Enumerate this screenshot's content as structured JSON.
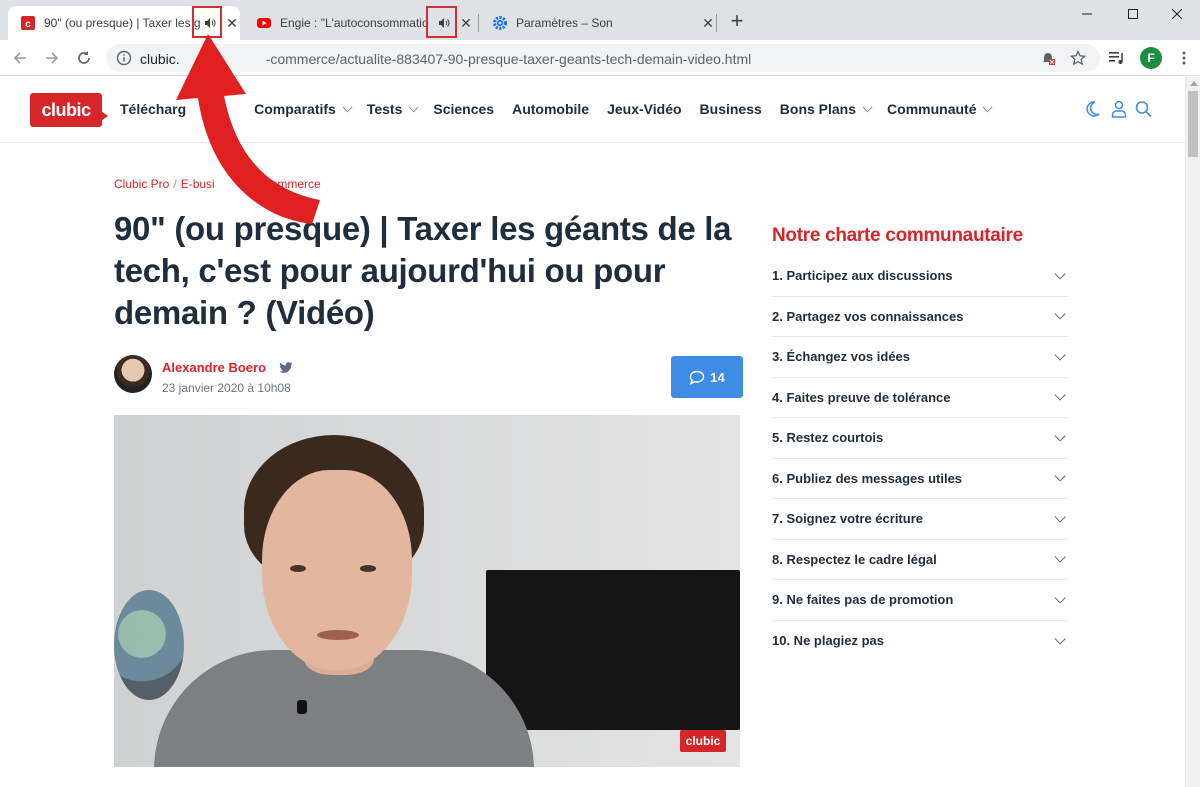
{
  "browser": {
    "tabs": [
      {
        "title": "90\" (ou presque) | Taxer les g",
        "favicon": "clubic-favicon",
        "audio": true,
        "active": true
      },
      {
        "title": "Engie : \"L'autoconsommatio",
        "favicon": "youtube-favicon",
        "audio": true,
        "active": false
      },
      {
        "title": "Paramètres – Son",
        "favicon": "settings-gear-favicon",
        "audio": false,
        "active": false
      }
    ],
    "new_tab": "+",
    "url_host": "clubic.",
    "url_rest": "-commerce/actualite-883407-90-presque-taxer-geants-tech-demain-video.html",
    "profile_initial": "F",
    "accent": "#1e8e3e"
  },
  "site": {
    "logo": "clubic",
    "brand_color": "#d7262a",
    "nav": [
      {
        "label": "Télécharg",
        "has_menu": false
      },
      {
        "label": "Comparatifs",
        "has_menu": true
      },
      {
        "label": "Tests",
        "has_menu": true
      },
      {
        "label": "Sciences",
        "has_menu": false
      },
      {
        "label": "Automobile",
        "has_menu": false
      },
      {
        "label": "Jeux-Vidéo",
        "has_menu": false
      },
      {
        "label": "Business",
        "has_menu": false
      },
      {
        "label": "Bons Plans",
        "has_menu": true
      },
      {
        "label": "Communauté",
        "has_menu": true
      }
    ]
  },
  "article": {
    "breadcrumb": [
      "Clubic Pro",
      "E-busi",
      "commerce"
    ],
    "title": "90\" (ou presque) | Taxer les géants de la tech, c'est pour aujourd'hui ou pour demain ? (Vidéo)",
    "author": "Alexandre Boero",
    "date": "23 janvier 2020 à 10h08",
    "comment_count": "14",
    "video_watermark": "clubic"
  },
  "sidebar": {
    "title": "Notre charte communautaire",
    "items": [
      "1. Participez aux discussions",
      "2. Partagez vos connaissances",
      "3. Échangez vos idées",
      "4. Faites preuve de tolérance",
      "5. Restez courtois",
      "6. Publiez des messages utiles",
      "7. Soignez votre écriture",
      "8. Respectez le cadre légal",
      "9. Ne faites pas de promotion",
      "10. Ne plagiez pas"
    ]
  },
  "annotation": {
    "color": "#e02020"
  }
}
